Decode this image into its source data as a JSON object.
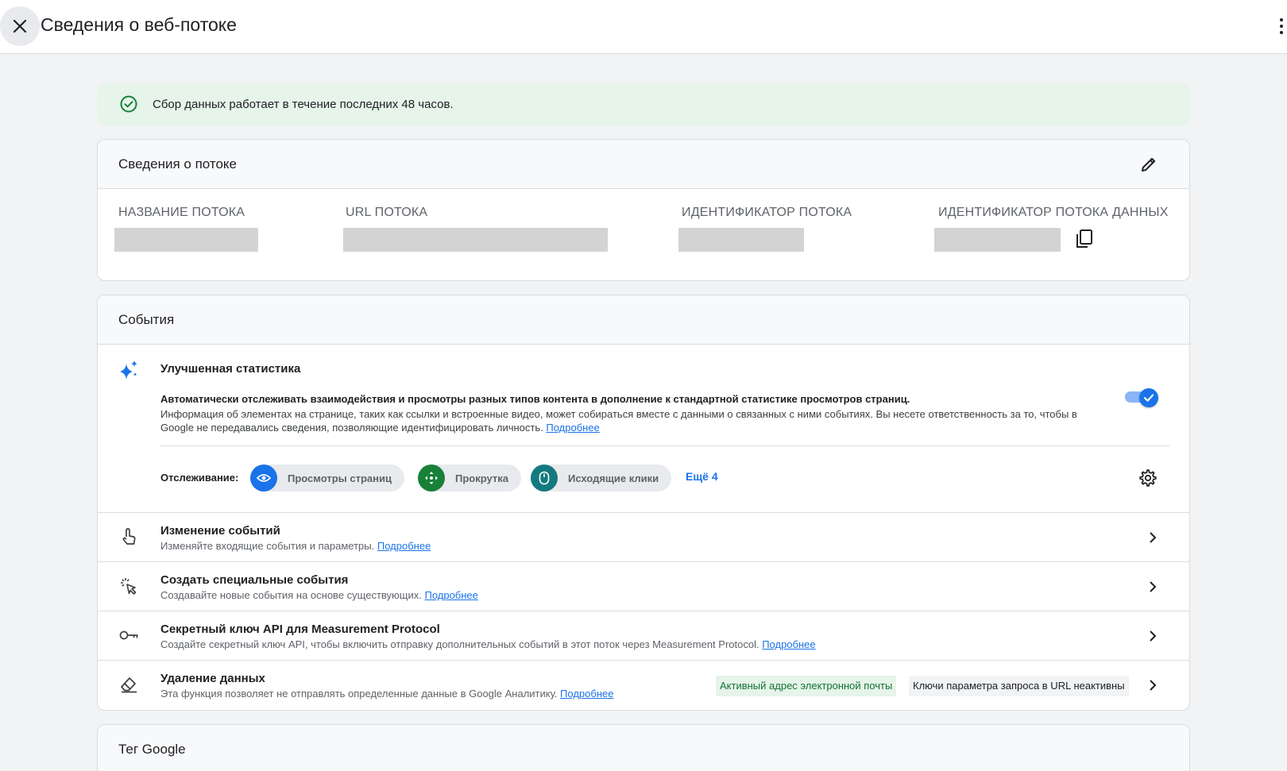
{
  "header": {
    "title": "Сведения о веб-потоке"
  },
  "banner": {
    "text": "Сбор данных работает в течение последних 48 часов."
  },
  "stream_details": {
    "title": "Сведения о потоке",
    "fields": [
      {
        "label": "НАЗВАНИЕ ПОТОКА"
      },
      {
        "label": "URL ПОТОКА"
      },
      {
        "label": "ИДЕНТИФИКАТОР ПОТОКА"
      },
      {
        "label": "ИДЕНТИФИКАТОР ПОТОКА ДАННЫХ"
      }
    ]
  },
  "events": {
    "title": "События",
    "enhanced": {
      "title": "Улучшенная статистика",
      "desc_bold": "Автоматически отслеживать взаимодействия и просмотры разных типов контента в дополнение к стандартной статистике просмотров страниц.",
      "desc": "Информация об элементах на странице, таких как ссылки и встроенные видео, может собираться вместе с данными о связанных с ними событиях. Вы несете ответственность за то, чтобы в Google не передавались сведения, позволяющие идентифицировать личность.",
      "link": "Подробнее",
      "enabled": true
    },
    "tracking_label": "Отслеживание:",
    "chips": [
      {
        "label": "Просмотры страниц",
        "color": "#1a73e8",
        "icon": "eye-icon"
      },
      {
        "label": "Прокрутка",
        "color": "#188038",
        "icon": "scroll-icon"
      },
      {
        "label": "Исходящие клики",
        "color": "#137a7f",
        "icon": "mouse-icon"
      }
    ],
    "more_chips": "Ещё 4",
    "rows": [
      {
        "title": "Изменение событий",
        "desc": "Изменяйте входящие события и параметры.",
        "link": "Подробнее",
        "icon": "touch-icon"
      },
      {
        "title": "Создать специальные события",
        "desc": "Создавайте новые события на основе существующих.",
        "link": "Подробнее",
        "icon": "click-icon"
      },
      {
        "title": "Секретный ключ API для Measurement Protocol",
        "desc": "Создайте секретный ключ API, чтобы включить отправку дополнительных событий в этот поток через Measurement Protocol.",
        "link": "Подробнее",
        "icon": "key-icon"
      },
      {
        "title": "Удаление данных",
        "desc": "Эта функция позволяет не отправлять определенные данные в Google Аналитику.",
        "link": "Подробнее",
        "icon": "eraser-icon",
        "badges": [
          "Активный адрес электронной почты",
          "Ключи параметра запроса в URL неактивны"
        ]
      }
    ]
  },
  "google_tag": {
    "title": "Тег Google"
  }
}
